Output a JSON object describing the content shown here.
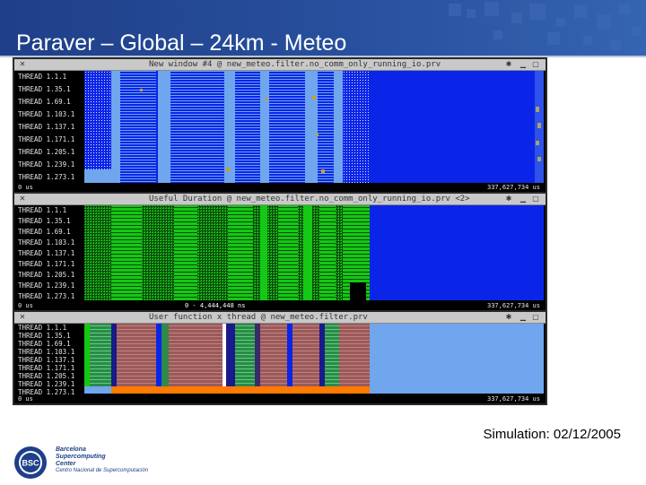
{
  "slide": {
    "title": "Paraver – Global – 24km - Meteo",
    "caption": "Simulation: 02/12/2005"
  },
  "windows": [
    {
      "title": "New window #4 @ new_meteo.filter.no_comm_only_running_io.prv",
      "thread_labels": [
        "THREAD 1.1.1",
        "THREAD 1.35.1",
        "THREAD 1.69.1",
        "THREAD 1.103.1",
        "THREAD 1.137.1",
        "THREAD 1.171.1",
        "THREAD 1.205.1",
        "THREAD 1.239.1",
        "THREAD 1.273.1"
      ],
      "footer_left": "0 us",
      "footer_center": "",
      "footer_right": "337,627,734 us"
    },
    {
      "title": "Useful Duration @ new_meteo.filter.no_comm_only_running_io.prv <2>",
      "thread_labels": [
        "THREAD 1.1.1",
        "THREAD 1.35.1",
        "THREAD 1.69.1",
        "THREAD 1.103.1",
        "THREAD 1.137.1",
        "THREAD 1.171.1",
        "THREAD 1.205.1",
        "THREAD 1.239.1",
        "THREAD 1.273.1"
      ],
      "footer_left": "0 us",
      "footer_center": "0 - 4,444,448 ns",
      "footer_right": "337,627,734 us"
    },
    {
      "title": "User function x thread @ new_meteo.filter.prv",
      "thread_labels": [
        "THREAD 1.1.1",
        "THREAD 1.35.1",
        "THREAD 1.69.1",
        "THREAD 1.103.1",
        "THREAD 1.137.1",
        "THREAD 1.171.1",
        "THREAD 1.205.1",
        "THREAD 1.239.1",
        "THREAD 1.273.1"
      ],
      "footer_left": "0 us",
      "footer_center": "",
      "footer_right": "337,627,734 us"
    }
  ],
  "logo": {
    "line1": "Barcelona",
    "line2": "Supercomputing",
    "line3": "Center",
    "line4": "Centro Nacional de Supercomputación",
    "mark": "BSC"
  },
  "colors": {
    "header": "#2a4f9c",
    "blue_state": "#0b25e8",
    "light_blue": "#6fa6ee",
    "green": "#14c814",
    "dark_green": "#0d4a0d",
    "orange": "#ff7a00",
    "gold": "#c8a028"
  },
  "icons": {
    "close": "close-icon",
    "pin": "pin-icon",
    "minimize": "minimize-icon",
    "maximize": "maximize-icon"
  }
}
